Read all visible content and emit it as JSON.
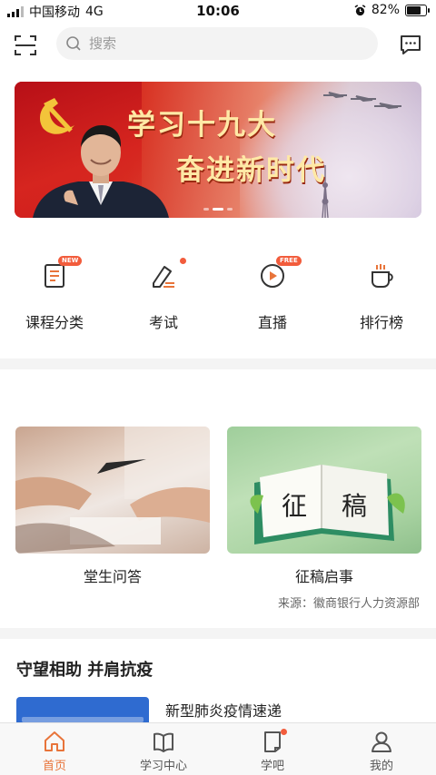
{
  "status_bar": {
    "carrier": "中国移动",
    "network": "4G",
    "time": "10:06",
    "battery": "82%",
    "battery_level": 0.82
  },
  "search": {
    "placeholder": "搜索",
    "value": ""
  },
  "banner": {
    "line1": "学习十九大",
    "line2": "奋进新时代",
    "pages": 3,
    "active_page": 1
  },
  "quick_nav": [
    {
      "label": "课程分类",
      "icon": "document-list-icon",
      "badge": "NEW"
    },
    {
      "label": "考试",
      "icon": "pencil-paper-icon",
      "badge": "dot"
    },
    {
      "label": "直播",
      "icon": "play-circle-icon",
      "badge": "FREE"
    },
    {
      "label": "排行榜",
      "icon": "coffee-cup-icon",
      "badge": ""
    }
  ],
  "cards": [
    {
      "title": "堂生问答",
      "source": ""
    },
    {
      "title": "征稿启事",
      "source": "来源：徽商银行人力资源部",
      "book_text": [
        "征",
        "稿"
      ]
    }
  ],
  "section": {
    "title": "守望相助 并肩抗疫",
    "news": [
      {
        "title": "新型肺炎疫情速递"
      }
    ]
  },
  "tab_bar": [
    {
      "label": "首页",
      "icon": "home-icon",
      "active": true
    },
    {
      "label": "学习中心",
      "icon": "book-icon",
      "active": false
    },
    {
      "label": "学吧",
      "icon": "note-icon",
      "active": false,
      "dot": true
    },
    {
      "label": "我的",
      "icon": "user-icon",
      "active": false
    }
  ],
  "colors": {
    "accent": "#e8743a",
    "badge": "#f25c3c",
    "banner_red": "#c9141a",
    "banner_text": "#ffe9a6"
  }
}
